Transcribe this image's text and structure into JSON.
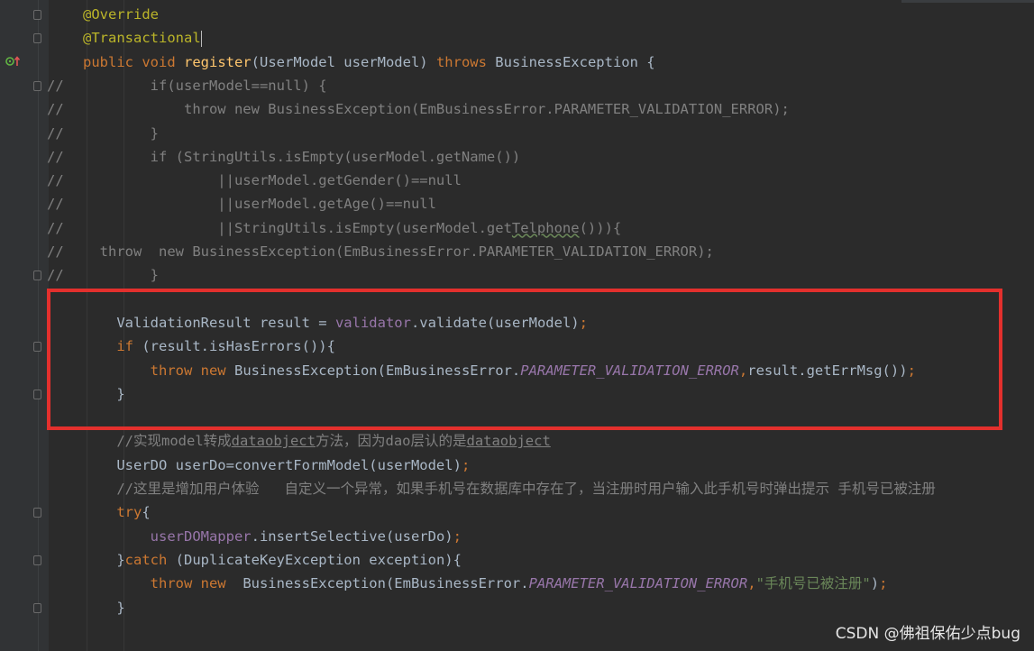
{
  "editor": {
    "lines": [
      {
        "comment_marker": "",
        "segments": [
          {
            "t": "@Override",
            "c": "ann"
          }
        ]
      },
      {
        "comment_marker": "",
        "segments": [
          {
            "t": "@Transactional",
            "c": "ann"
          }
        ],
        "caret": true
      },
      {
        "comment_marker": "",
        "segments": [
          {
            "t": "public ",
            "c": "kw"
          },
          {
            "t": "void ",
            "c": "kw"
          },
          {
            "t": "register",
            "c": "fn"
          },
          {
            "t": "(UserModel userModel) ",
            "c": ""
          },
          {
            "t": "throws ",
            "c": "kw"
          },
          {
            "t": "BusinessException {",
            "c": ""
          }
        ]
      },
      {
        "comment_marker": "//",
        "segments": [
          {
            "t": "        if(userModel==null) {",
            "c": "cmt"
          }
        ]
      },
      {
        "comment_marker": "//",
        "segments": [
          {
            "t": "            throw new BusinessException(EmBusinessError.PARAMETER_VALIDATION_ERROR);",
            "c": "cmt"
          }
        ]
      },
      {
        "comment_marker": "//",
        "segments": [
          {
            "t": "        }",
            "c": "cmt"
          }
        ]
      },
      {
        "comment_marker": "//",
        "segments": [
          {
            "t": "        if (StringUtils.isEmpty(userModel.getName())",
            "c": "cmt"
          }
        ]
      },
      {
        "comment_marker": "//",
        "segments": [
          {
            "t": "                ||userModel.getGender()==null",
            "c": "cmt"
          }
        ]
      },
      {
        "comment_marker": "//",
        "segments": [
          {
            "t": "                ||userModel.getAge()==null",
            "c": "cmt"
          }
        ]
      },
      {
        "comment_marker": "//",
        "segments": [
          {
            "t": "                ||StringUtils.isEmpty(userModel.get",
            "c": "cmt"
          },
          {
            "t": "Telphone",
            "c": "cmt wavy"
          },
          {
            "t": "())){",
            "c": "cmt"
          }
        ]
      },
      {
        "comment_marker": "//",
        "segments": [
          {
            "t": "  throw  new BusinessException(EmBusinessError.PARAMETER_VALIDATION_ERROR);",
            "c": "cmt"
          }
        ]
      },
      {
        "comment_marker": "//",
        "segments": [
          {
            "t": "        }",
            "c": "cmt"
          }
        ]
      },
      {
        "comment_marker": "",
        "segments": []
      },
      {
        "comment_marker": "",
        "segments": [
          {
            "t": "    ValidationResult result = ",
            "c": ""
          },
          {
            "t": "validator",
            "c": "fld"
          },
          {
            "t": ".validate(userModel)",
            "c": ""
          },
          {
            "t": ";",
            "c": "kw"
          }
        ]
      },
      {
        "comment_marker": "",
        "segments": [
          {
            "t": "    ",
            "c": ""
          },
          {
            "t": "if ",
            "c": "kw"
          },
          {
            "t": "(result.isHasErrors()){",
            "c": ""
          }
        ]
      },
      {
        "comment_marker": "",
        "segments": [
          {
            "t": "        ",
            "c": ""
          },
          {
            "t": "throw new ",
            "c": "kw"
          },
          {
            "t": "BusinessException(EmBusinessError.",
            "c": ""
          },
          {
            "t": "PARAMETER_VALIDATION_ERROR",
            "c": "const"
          },
          {
            "t": ",",
            "c": "kw"
          },
          {
            "t": "result.getErrMsg())",
            "c": ""
          },
          {
            "t": ";",
            "c": "kw"
          }
        ]
      },
      {
        "comment_marker": "",
        "segments": [
          {
            "t": "    }",
            "c": ""
          }
        ]
      },
      {
        "comment_marker": "",
        "segments": []
      },
      {
        "comment_marker": "",
        "segments": [
          {
            "t": "    //实现model转成",
            "c": "cmt"
          },
          {
            "t": "dataobject",
            "c": "cmt uline"
          },
          {
            "t": "方法，因为dao层认的是",
            "c": "cmt"
          },
          {
            "t": "dataobject",
            "c": "cmt uline"
          }
        ]
      },
      {
        "comment_marker": "",
        "segments": [
          {
            "t": "    UserDO userDo=convertFormModel(userModel)",
            "c": ""
          },
          {
            "t": ";",
            "c": "kw"
          }
        ]
      },
      {
        "comment_marker": "",
        "segments": [
          {
            "t": "    //这里是增加用户体验   自定义一个异常，如果手机号在数据库中存在了，当注册时用户输入此手机号时弹出提示 手机号已被注册",
            "c": "cmt"
          }
        ]
      },
      {
        "comment_marker": "",
        "segments": [
          {
            "t": "    ",
            "c": ""
          },
          {
            "t": "try",
            "c": "kw"
          },
          {
            "t": "{",
            "c": ""
          }
        ]
      },
      {
        "comment_marker": "",
        "segments": [
          {
            "t": "        ",
            "c": ""
          },
          {
            "t": "userDOMapper",
            "c": "fld"
          },
          {
            "t": ".insertSelective(userDo)",
            "c": ""
          },
          {
            "t": ";",
            "c": "kw"
          }
        ]
      },
      {
        "comment_marker": "",
        "segments": [
          {
            "t": "    }",
            "c": ""
          },
          {
            "t": "catch ",
            "c": "kw"
          },
          {
            "t": "(DuplicateKeyException exception){",
            "c": ""
          }
        ]
      },
      {
        "comment_marker": "",
        "segments": [
          {
            "t": "        ",
            "c": ""
          },
          {
            "t": "throw new  ",
            "c": "kw"
          },
          {
            "t": "BusinessException(EmBusinessError.",
            "c": ""
          },
          {
            "t": "PARAMETER_VALIDATION_ERROR",
            "c": "const"
          },
          {
            "t": ",",
            "c": "kw"
          },
          {
            "t": "\"手机号已被注册\"",
            "c": "str"
          },
          {
            "t": ")",
            "c": ""
          },
          {
            "t": ";",
            "c": "kw"
          }
        ]
      },
      {
        "comment_marker": "",
        "segments": [
          {
            "t": "    }",
            "c": ""
          }
        ]
      }
    ]
  },
  "watermark": "CSDN @佛祖保佑少点bug",
  "colors": {
    "background": "#2b2b2b",
    "gutter": "#313335",
    "annotation": "#bbb529",
    "keyword": "#cc7832",
    "function": "#ffc66d",
    "field": "#9876aa",
    "comment": "#808080",
    "string": "#6a8759",
    "text": "#a9b7c6",
    "highlight_box": "#e3302d"
  },
  "icons": [
    "override-gutter-icon",
    "fold-marker-icon"
  ]
}
